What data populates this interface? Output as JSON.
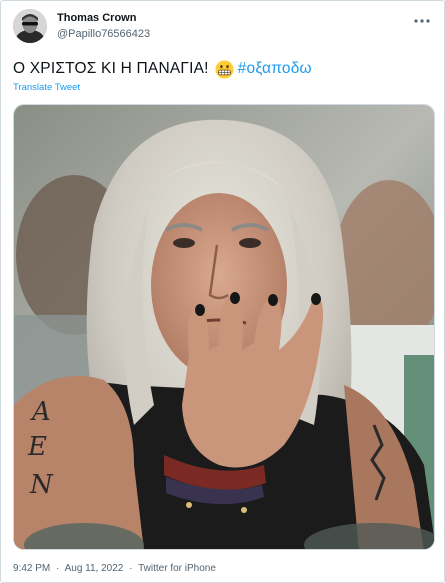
{
  "author": {
    "display_name": "Thomas Crown",
    "handle": "@Papillo76566423"
  },
  "menu_icon": "more-horizontal-icon",
  "tweet": {
    "text": "Ο ΧΡΙΣΤΟΣ ΚΙ Η ΠΑΝΑΓΙΑ!",
    "emoji": "grimacing-face-emoji",
    "hashtag": "#οξαποδω",
    "translate_label": "Translate Tweet"
  },
  "media": {
    "tattoo_text": "AEN"
  },
  "meta": {
    "time": "9:42 PM",
    "separator": "·",
    "date": "Aug 11, 2022",
    "source": "Twitter for iPhone"
  },
  "colors": {
    "link": "#1d9bf0",
    "secondary_text": "#536471",
    "border": "#cfd9de"
  }
}
